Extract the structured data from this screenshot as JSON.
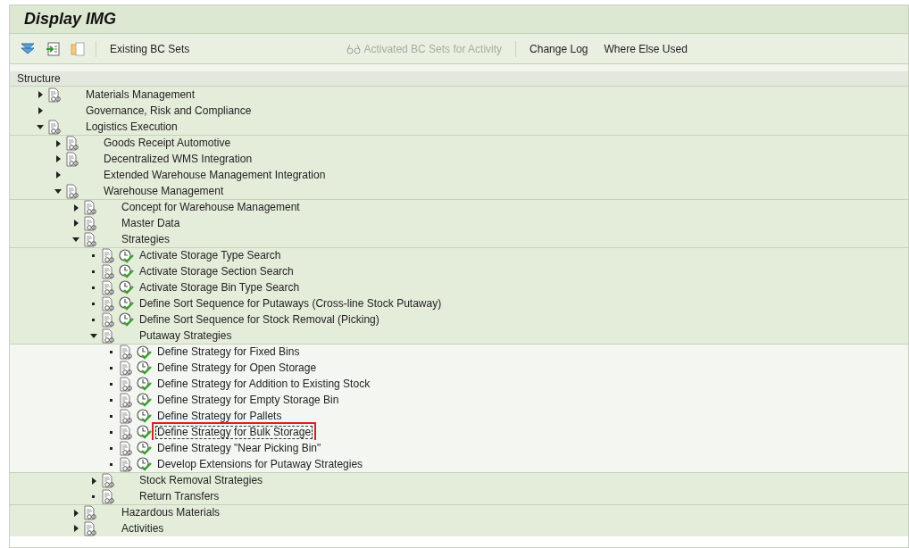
{
  "window": {
    "title": "Display IMG"
  },
  "toolbar": [
    {
      "kind": "icon"
    },
    {
      "kind": "icon"
    },
    {
      "kind": "icon"
    },
    {
      "kind": "separator"
    },
    {
      "kind": "text",
      "label": "Existing BC Sets",
      "disabled": false
    },
    {
      "kind": "spacer"
    },
    {
      "kind": "icon_text",
      "label": "Activated BC Sets for Activity",
      "disabled": true
    },
    {
      "kind": "separator"
    },
    {
      "kind": "text",
      "label": "Change Log",
      "disabled": false
    },
    {
      "kind": "text",
      "label": "Where Else Used",
      "disabled": false
    }
  ],
  "tree": {
    "header": "Structure",
    "items": [
      {
        "label": "Materials Management",
        "kind": "folder",
        "expanded": false,
        "doc": true,
        "activity": false,
        "selected": false
      },
      {
        "label": "Governance, Risk and Compliance",
        "kind": "folder",
        "expanded": false,
        "doc": false,
        "activity": false,
        "selected": false
      },
      {
        "label": "Logistics Execution",
        "kind": "folder",
        "expanded": true,
        "doc": true,
        "activity": false,
        "selected": false,
        "children": [
          {
            "label": "Goods Receipt Automotive",
            "kind": "folder",
            "expanded": false,
            "doc": true,
            "activity": false,
            "selected": false
          },
          {
            "label": "Decentralized WMS Integration",
            "kind": "folder",
            "expanded": false,
            "doc": true,
            "activity": false,
            "selected": false
          },
          {
            "label": "Extended Warehouse Management Integration",
            "kind": "folder",
            "expanded": false,
            "doc": false,
            "activity": false,
            "selected": false
          },
          {
            "label": "Warehouse Management",
            "kind": "folder",
            "expanded": true,
            "doc": true,
            "activity": false,
            "selected": false,
            "children": [
              {
                "label": "Concept for Warehouse Management",
                "kind": "folder",
                "expanded": false,
                "doc": true,
                "activity": false,
                "selected": false
              },
              {
                "label": "Master Data",
                "kind": "folder",
                "expanded": false,
                "doc": true,
                "activity": false,
                "selected": false
              },
              {
                "label": "Strategies",
                "kind": "folder",
                "expanded": true,
                "doc": true,
                "activity": false,
                "selected": false,
                "children": [
                  {
                    "label": "Activate Storage Type Search",
                    "kind": "leaf",
                    "doc": true,
                    "activity": true,
                    "selected": false
                  },
                  {
                    "label": "Activate Storage Section Search",
                    "kind": "leaf",
                    "doc": true,
                    "activity": true,
                    "selected": false
                  },
                  {
                    "label": "Activate Storage Bin Type Search",
                    "kind": "leaf",
                    "doc": true,
                    "activity": true,
                    "selected": false
                  },
                  {
                    "label": "Define Sort Sequence for Putaways (Cross-line Stock Putaway)",
                    "kind": "leaf",
                    "doc": true,
                    "activity": true,
                    "selected": false
                  },
                  {
                    "label": "Define Sort Sequence for Stock Removal (Picking)",
                    "kind": "leaf",
                    "doc": true,
                    "activity": true,
                    "selected": false
                  },
                  {
                    "label": "Putaway Strategies",
                    "kind": "folder",
                    "expanded": true,
                    "doc": true,
                    "activity": false,
                    "selected": false,
                    "children": [
                      {
                        "label": "Define Strategy for Fixed Bins",
                        "kind": "leaf",
                        "doc": true,
                        "activity": true,
                        "selected": false
                      },
                      {
                        "label": "Define Strategy for Open Storage",
                        "kind": "leaf",
                        "doc": true,
                        "activity": true,
                        "selected": false
                      },
                      {
                        "label": "Define Strategy for Addition to Existing Stock",
                        "kind": "leaf",
                        "doc": true,
                        "activity": true,
                        "selected": false
                      },
                      {
                        "label": "Define Strategy for Empty Storage Bin",
                        "kind": "leaf",
                        "doc": true,
                        "activity": true,
                        "selected": false
                      },
                      {
                        "label": "Define Strategy for Pallets",
                        "kind": "leaf",
                        "doc": true,
                        "activity": true,
                        "selected": false
                      },
                      {
                        "label": "Define Strategy for Bulk Storage",
                        "kind": "leaf",
                        "doc": true,
                        "activity": true,
                        "selected": true
                      },
                      {
                        "label": "Define Strategy \"Near Picking Bin\"",
                        "kind": "leaf",
                        "doc": true,
                        "activity": true,
                        "selected": false
                      },
                      {
                        "label": "Develop Extensions for Putaway Strategies",
                        "kind": "leaf",
                        "doc": true,
                        "activity": true,
                        "selected": false
                      }
                    ]
                  },
                  {
                    "label": "Stock Removal Strategies",
                    "kind": "folder",
                    "expanded": false,
                    "doc": true,
                    "activity": false,
                    "selected": false
                  },
                  {
                    "label": "Return Transfers",
                    "kind": "leaf",
                    "doc": true,
                    "activity": false,
                    "selected": false
                  }
                ]
              },
              {
                "label": "Hazardous Materials",
                "kind": "folder",
                "expanded": false,
                "doc": true,
                "activity": false,
                "selected": false
              },
              {
                "label": "Activities",
                "kind": "folder",
                "expanded": false,
                "doc": true,
                "activity": false,
                "selected": false
              }
            ]
          }
        ]
      }
    ]
  }
}
